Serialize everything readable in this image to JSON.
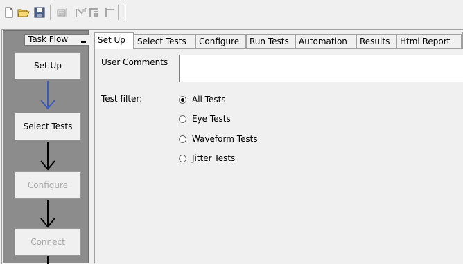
{
  "toolbar": {
    "icons": [
      "new-file-icon",
      "open-folder-icon",
      "save-icon",
      "results-icon",
      "run-marked-icon",
      "run-all-icon",
      "stop-icon"
    ]
  },
  "taskflow": {
    "title": "Task Flow",
    "steps": [
      {
        "label": "Set Up",
        "enabled": true
      },
      {
        "label": "Select Tests",
        "enabled": true
      },
      {
        "label": "Configure",
        "enabled": false
      },
      {
        "label": "Connect",
        "enabled": false
      }
    ],
    "first_arrow_color": "#3b5bb8"
  },
  "tabs": [
    {
      "label": "Set Up",
      "active": true
    },
    {
      "label": "Select Tests",
      "active": false
    },
    {
      "label": "Configure",
      "active": false
    },
    {
      "label": "Run Tests",
      "active": false
    },
    {
      "label": "Automation",
      "active": false
    },
    {
      "label": "Results",
      "active": false
    },
    {
      "label": "Html Report",
      "active": false
    }
  ],
  "setup": {
    "user_comments_label": "User Comments",
    "user_comments_value": "",
    "test_filter_label": "Test filter:",
    "filter_options": [
      {
        "label": "All Tests",
        "selected": true
      },
      {
        "label": "Eye Tests",
        "selected": false
      },
      {
        "label": "Waveform Tests",
        "selected": false
      },
      {
        "label": "Jitter Tests",
        "selected": false
      }
    ]
  }
}
